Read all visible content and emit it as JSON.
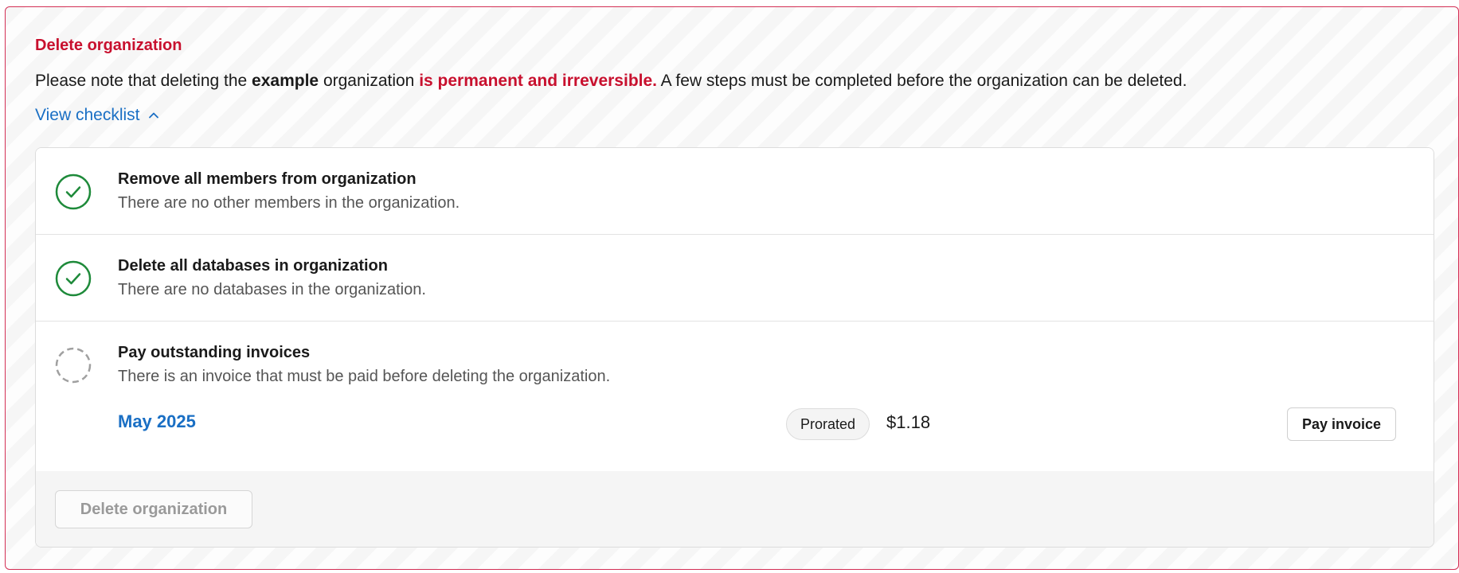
{
  "section": {
    "title": "Delete organization",
    "note_prefix": "Please note that deleting the ",
    "org_name": "example",
    "note_middle": " organization ",
    "note_danger": "is permanent and irreversible.",
    "note_suffix": " A few steps must be completed before the organization can be deleted.",
    "view_checklist_label": "View checklist",
    "chevron_icon": "chevron-up-icon"
  },
  "checklist": [
    {
      "title": "Remove all members from organization",
      "description": "There are no other members in the organization.",
      "status": "complete",
      "icon": "check-circle-icon"
    },
    {
      "title": "Delete all databases in organization",
      "description": "There are no databases in the organization.",
      "status": "complete",
      "icon": "check-circle-icon"
    },
    {
      "title": "Pay outstanding invoices",
      "description": "There is an invoice that must be paid before deleting the organization.",
      "status": "pending",
      "icon": "dashed-circle-icon"
    }
  ],
  "invoice": {
    "period": "May 2025",
    "badge": "Prorated",
    "amount": "$1.18",
    "pay_label": "Pay invoice"
  },
  "footer": {
    "delete_label": "Delete organization",
    "delete_disabled": true
  },
  "colors": {
    "danger": "#c8102e",
    "link": "#1a6fc4",
    "success": "#1e8a3a",
    "pending": "#a0a0a0"
  }
}
